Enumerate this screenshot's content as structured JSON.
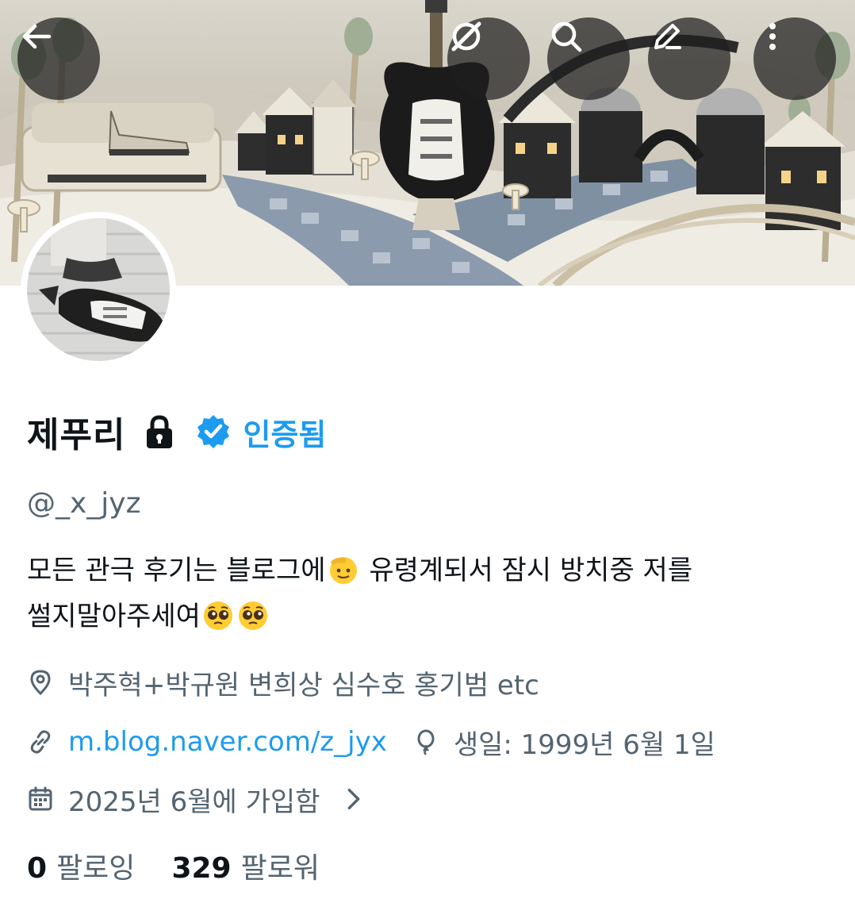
{
  "header": {
    "back_icon": "arrow-left-icon",
    "grok_icon": "grok-slash-icon",
    "search_icon": "search-icon",
    "edit_icon": "pencil-icon",
    "more_icon": "more-vertical-icon"
  },
  "profile": {
    "display_name": "제푸리",
    "protected_icon": "lock-icon",
    "verified_icon": "verified-badge-icon",
    "verified_label": "인증됨",
    "handle": "@_x_jyz",
    "bio_line1": "모든 관극 후기는 블로그에",
    "bio_line1_rest": " 유령계되서 잠시 방치중 저를",
    "bio_line2": "썰지말아주세여",
    "bio_emojis": [
      "saluting-face",
      "pleading-face",
      "pleading-face"
    ],
    "location": "박주혁+박규원 변희상 심수호 홍기범 etc",
    "website": "m.blog.naver.com/z_jyx",
    "birthday": "생일: 1999년 6월 1일",
    "joined": "2025년 6월에 가입함",
    "following_count": "0",
    "following_label": "팔로잉",
    "followers_count": "329",
    "followers_label": "팔로워"
  },
  "colors": {
    "accent": "#1d9bf0",
    "secondary_text": "#536471",
    "primary_text": "#0f1419"
  }
}
